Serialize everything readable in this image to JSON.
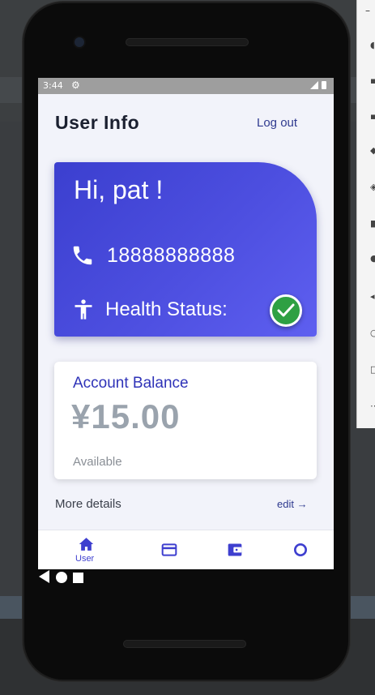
{
  "status_bar": {
    "time": "3:44"
  },
  "header": {
    "title": "User Info",
    "logout_label": "Log out"
  },
  "user_card": {
    "greeting": "Hi, pat !",
    "phone_number": "18888888888",
    "health_label": "Health Status:",
    "health_ok": true
  },
  "balance": {
    "title": "Account Balance",
    "amount": "¥15.00",
    "status": "Available"
  },
  "footer": {
    "more_details": "More details",
    "edit_label": "edit →"
  },
  "bottom_nav": {
    "items": [
      {
        "icon": "home-icon",
        "label": "User",
        "active": true
      },
      {
        "icon": "credit-card-icon",
        "label": ""
      },
      {
        "icon": "wallet-icon",
        "label": ""
      },
      {
        "icon": "circle-icon",
        "label": ""
      }
    ]
  },
  "colors": {
    "accent": "#3e3fcf",
    "card_gradient_start": "#3b3fcf",
    "card_gradient_end": "#5e5ff0",
    "success": "#2ea043"
  }
}
